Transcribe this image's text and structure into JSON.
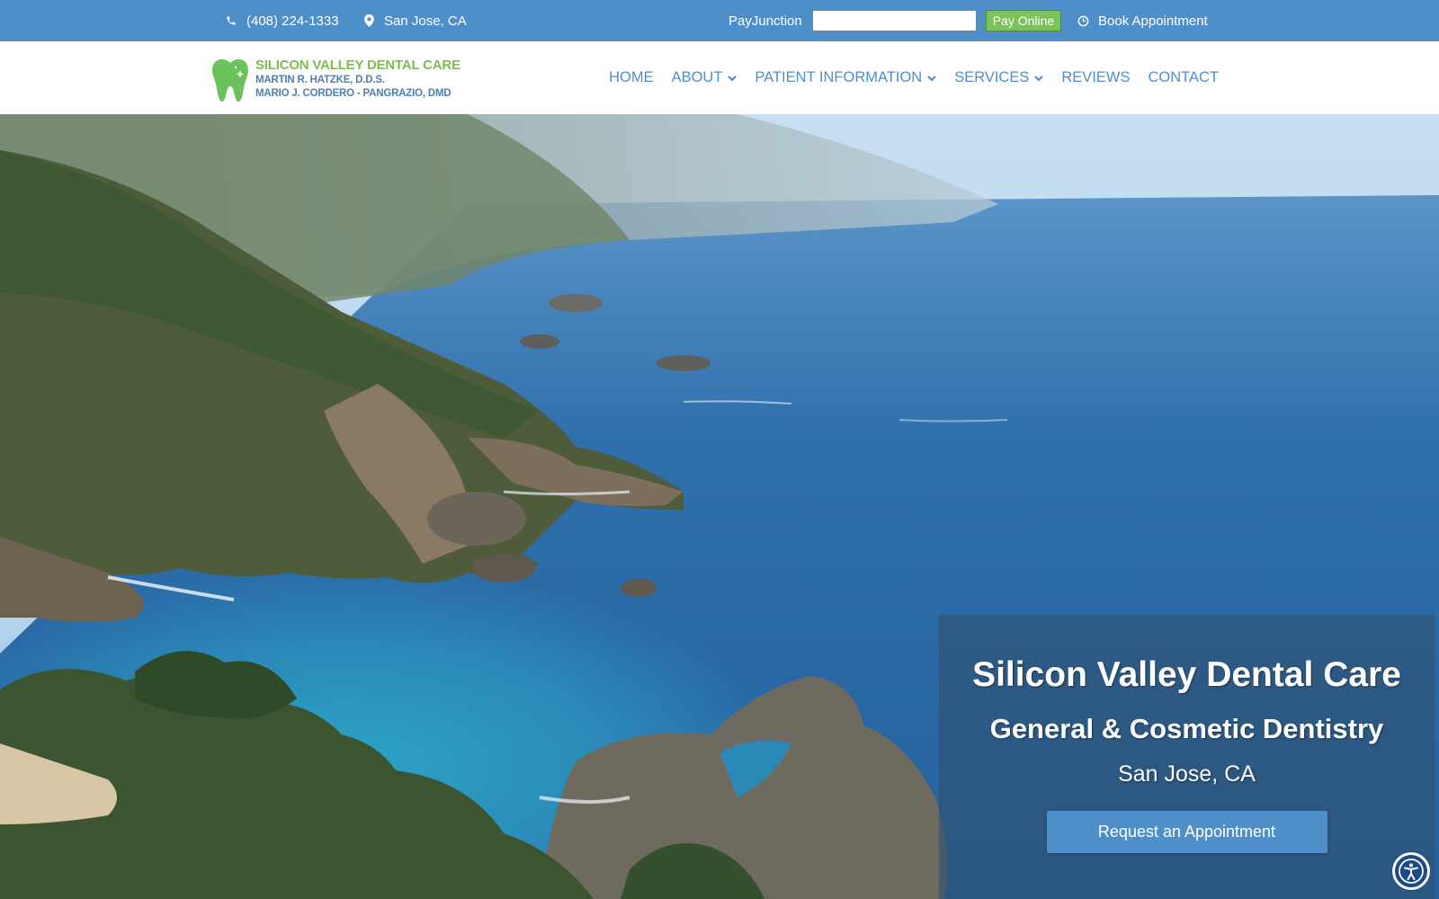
{
  "topbar": {
    "phone": "(408) 224-1333",
    "location": "San Jose, CA",
    "pay_label": "PayJunction",
    "pay_input_value": "",
    "pay_button": "Pay Online",
    "book": "Book Appointment",
    "icons": {
      "phone": "phone-icon",
      "location": "map-pin-icon",
      "book": "clock-icon"
    }
  },
  "logo": {
    "title": "SILICON VALLEY DENTAL CARE",
    "line1": "MARTIN R. HATZKE, D.D.S.",
    "line2": "MARIO J. CORDERO - PANGRAZIO, DMD",
    "icon": "tooth-icon"
  },
  "nav": {
    "items": [
      {
        "label": "HOME",
        "dropdown": false
      },
      {
        "label": "ABOUT",
        "dropdown": true
      },
      {
        "label": "PATIENT INFORMATION",
        "dropdown": true
      },
      {
        "label": "SERVICES",
        "dropdown": true
      },
      {
        "label": "REVIEWS",
        "dropdown": false
      },
      {
        "label": "CONTACT",
        "dropdown": false
      }
    ]
  },
  "hero": {
    "title": "Silicon Valley Dental Care",
    "subtitle": "General & Cosmetic Dentistry",
    "city": "San Jose, CA",
    "cta": "Request an Appointment"
  },
  "colors": {
    "brand_blue": "#4f8fc9",
    "brand_green": "#7cbd4d",
    "pay_button": "#7cc15a",
    "logo_sub": "#4f7fae",
    "a11y": "#1c4a86"
  },
  "accessibility_icon": "accessibility-icon"
}
